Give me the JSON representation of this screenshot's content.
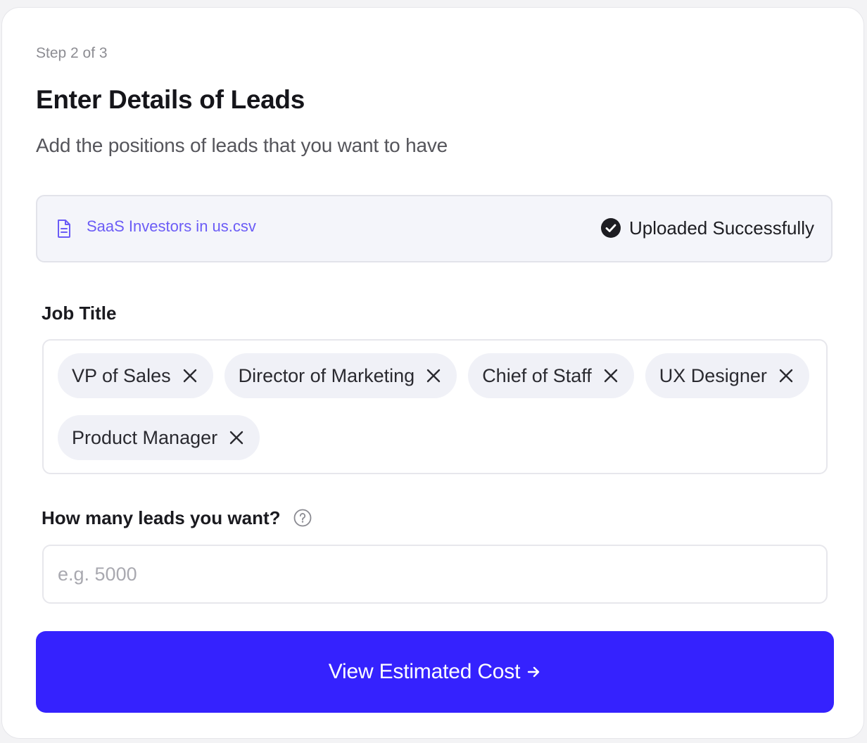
{
  "header": {
    "step": "Step 2 of 3",
    "title": "Enter Details of Leads",
    "subtitle": "Add the positions of leads that you want to have"
  },
  "upload": {
    "file_name": "SaaS Investors in us.csv",
    "file_icon": "document-icon",
    "status_icon": "check-circle-icon",
    "status": "Uploaded Successfully"
  },
  "job_title": {
    "label": "Job Title",
    "tags": [
      {
        "label": "VP of Sales"
      },
      {
        "label": "Director of Marketing"
      },
      {
        "label": "Chief of Staff"
      },
      {
        "label": "UX Designer"
      },
      {
        "label": "Product Manager"
      }
    ]
  },
  "leads": {
    "label": "How many leads you want?",
    "help_icon": "question-circle-icon",
    "value": "",
    "placeholder": "e.g. 5000"
  },
  "cta": {
    "label": "View Estimated Cost",
    "icon": "arrow-right-icon"
  },
  "colors": {
    "accent": "#3522fe",
    "file_link": "#6b5cf6",
    "tag_bg": "#f0f1f7",
    "upload_bg": "#f4f5fa"
  }
}
